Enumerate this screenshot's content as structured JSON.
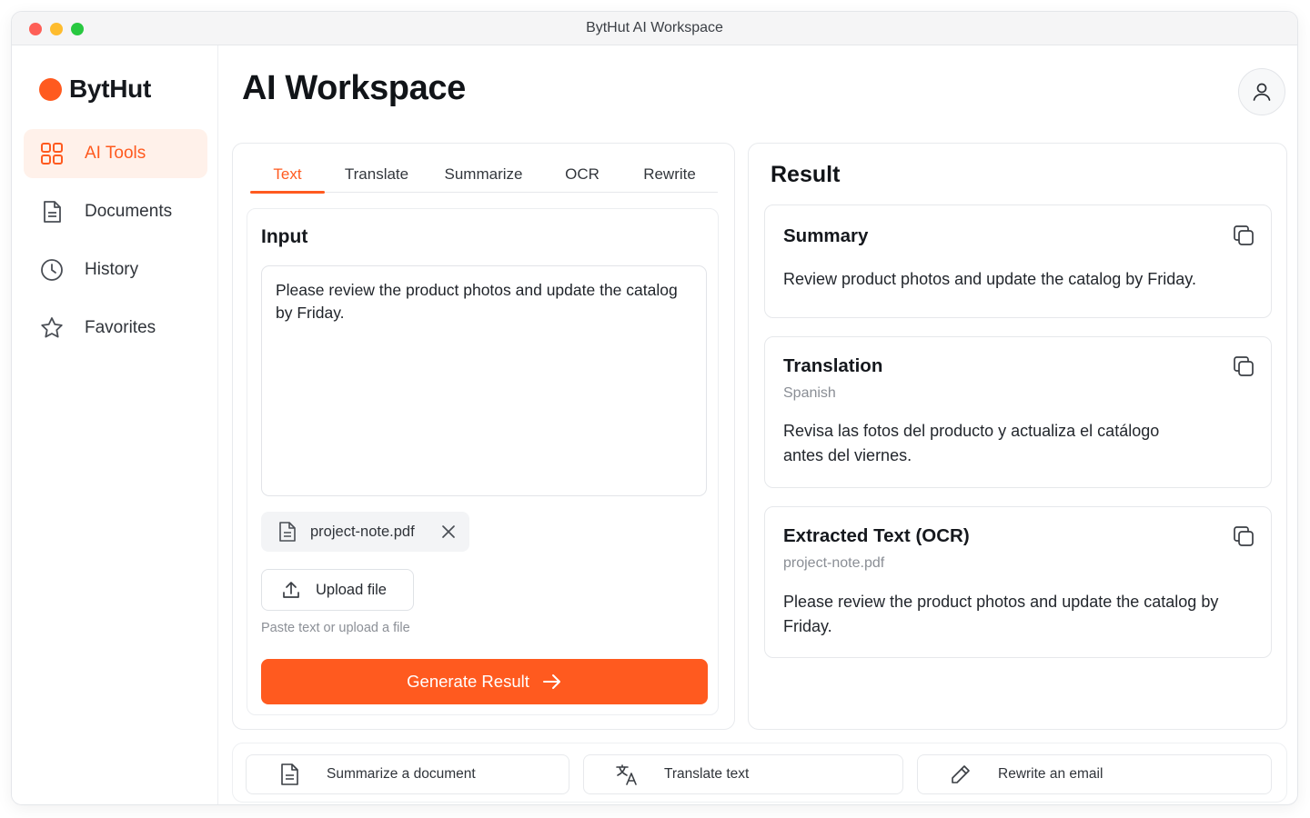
{
  "window": {
    "title": "BytHut AI Workspace"
  },
  "brand": {
    "name": "BytHut",
    "accent": "#ff5a1f"
  },
  "sidebar": {
    "items": [
      {
        "label": "AI Tools",
        "icon": "grid-icon",
        "active": true
      },
      {
        "label": "Documents",
        "icon": "document-icon",
        "active": false
      },
      {
        "label": "History",
        "icon": "clock-icon",
        "active": false
      },
      {
        "label": "Favorites",
        "icon": "star-icon",
        "active": false
      }
    ]
  },
  "header": {
    "title": "AI Workspace",
    "avatar_icon": "user-icon"
  },
  "tabs": [
    {
      "label": "Text",
      "active": true
    },
    {
      "label": "Translate",
      "active": false
    },
    {
      "label": "Summarize",
      "active": false
    },
    {
      "label": "OCR",
      "active": false
    },
    {
      "label": "Rewrite",
      "active": false
    }
  ],
  "input": {
    "heading": "Input",
    "text": "Please review the product photos and update the catalog by Friday.",
    "file_name": "project-note.pdf",
    "upload_label": "Upload file",
    "hint": "Paste text or upload a file",
    "generate_label": "Generate Result"
  },
  "result": {
    "heading": "Result",
    "summary": {
      "title": "Summary",
      "body": "Review product photos and update the catalog by Friday."
    },
    "translation": {
      "title": "Translation",
      "language": "Spanish",
      "body": "Revisa las fotos del producto y actualiza el catálogo antes del viernes."
    },
    "ocr": {
      "title": "Extracted Text (OCR)",
      "source": "project-note.pdf",
      "body": "Please review the product photos and update the catalog by Friday."
    }
  },
  "quick_actions": [
    {
      "label": "Summarize a document",
      "icon": "document-icon"
    },
    {
      "label": "Translate text",
      "icon": "translate-icon"
    },
    {
      "label": "Rewrite an email",
      "icon": "pencil-icon"
    }
  ]
}
